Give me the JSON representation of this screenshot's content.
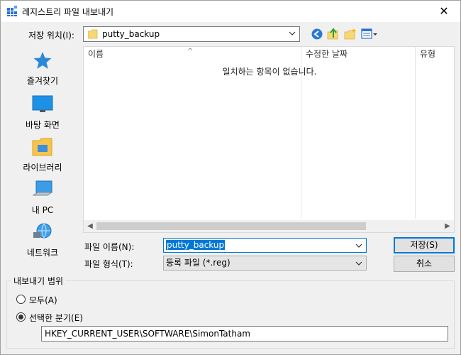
{
  "window": {
    "title": "레지스트리 파일 내보내기",
    "close_glyph": "✕"
  },
  "location": {
    "label": "저장 위치(I):",
    "value": "putty_backup"
  },
  "toolbar": {
    "icons": [
      "back-icon",
      "up-folder-icon",
      "new-folder-icon",
      "view-menu-icon"
    ]
  },
  "places": [
    {
      "label": "즐겨찾기",
      "icon": "star-icon"
    },
    {
      "label": "바탕 화면",
      "icon": "desktop-icon"
    },
    {
      "label": "라이브러리",
      "icon": "library-icon"
    },
    {
      "label": "내 PC",
      "icon": "computer-icon"
    },
    {
      "label": "네트워크",
      "icon": "network-icon"
    }
  ],
  "filelist": {
    "columns": [
      "이름",
      "수정한 날짜",
      "유형"
    ],
    "empty_message": "일치하는 항목이 없습니다."
  },
  "filename": {
    "label": "파일 이름(N):",
    "value": "putty_backup"
  },
  "filetype": {
    "label": "파일 형식(T):",
    "value": "등록 파일 (*.reg)"
  },
  "buttons": {
    "save": "저장(S)",
    "cancel": "취소"
  },
  "export_range": {
    "title": "내보내기 범위",
    "all_label": "모두(A)",
    "branch_label": "선택한 분기(E)",
    "branch_value": "HKEY_CURRENT_USER\\SOFTWARE\\SimonTatham",
    "selected": "branch"
  },
  "colors": {
    "accent": "#0078d7",
    "folder": "#f8d775",
    "star": "#2b88d8"
  }
}
